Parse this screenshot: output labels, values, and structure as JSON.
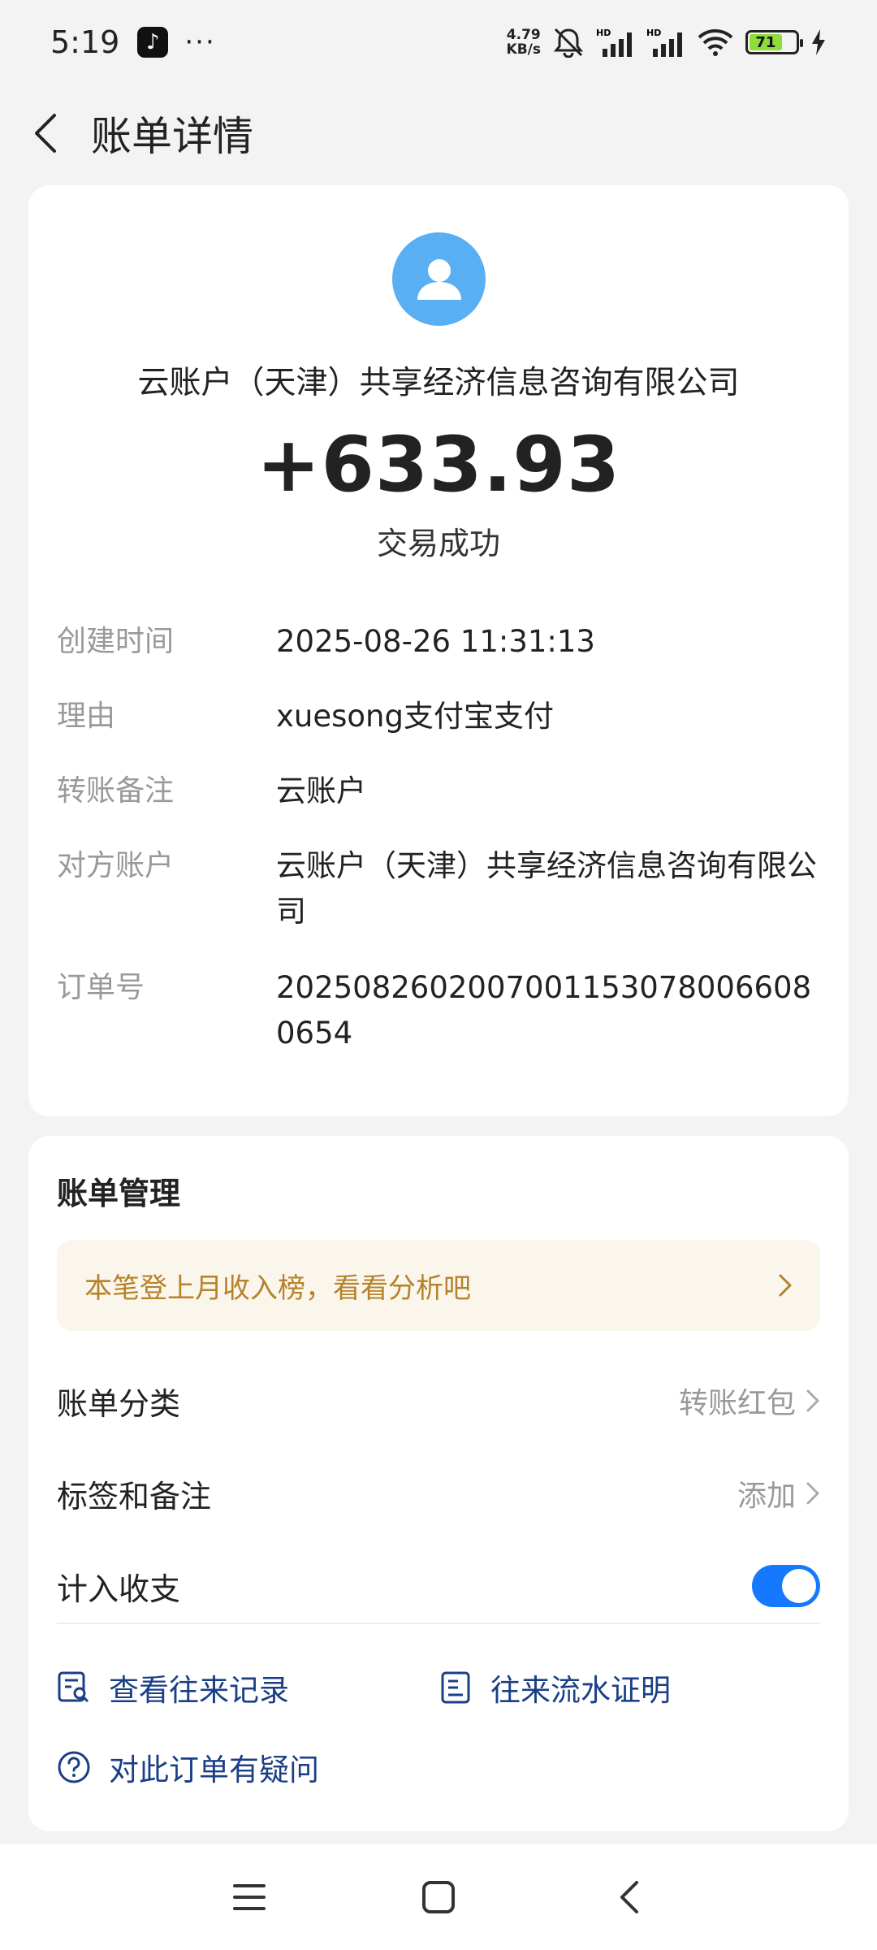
{
  "status_bar": {
    "time": "5:19",
    "dots": "···",
    "net_speed_value": "4.79",
    "net_speed_unit": "KB/s",
    "battery": "71"
  },
  "header": {
    "title": "账单详情",
    "back_icon": "chevron-left-icon"
  },
  "summary": {
    "payer": "云账户（天津）共享经济信息咨询有限公司",
    "amount": "+633.93",
    "status": "交易成功"
  },
  "details": [
    {
      "label": "创建时间",
      "value": "2025-08-26 11:31:13"
    },
    {
      "label": "理由",
      "value": "xuesong支付宝支付"
    },
    {
      "label": "转账备注",
      "value": "云账户"
    },
    {
      "label": "对方账户",
      "value": "云账户（天津）共享经济信息咨询有限公司"
    },
    {
      "label": "订单号",
      "value": "2025082602007001153078006608 0654"
    }
  ],
  "management": {
    "title": "账单管理",
    "banner": "本笔登上月收入榜，看看分析吧",
    "category_label": "账单分类",
    "category_value": "转账红包",
    "tags_label": "标签和备注",
    "tags_value": "添加",
    "include_label": "计入收支",
    "include_on": true,
    "link_records": "查看往来记录",
    "link_certificate": "往来流水证明",
    "link_question": "对此订单有疑问"
  },
  "colors": {
    "accent": "#1677ff",
    "avatar": "#5aaff3",
    "banner_text": "#b5822a",
    "link": "#1b3f86"
  }
}
